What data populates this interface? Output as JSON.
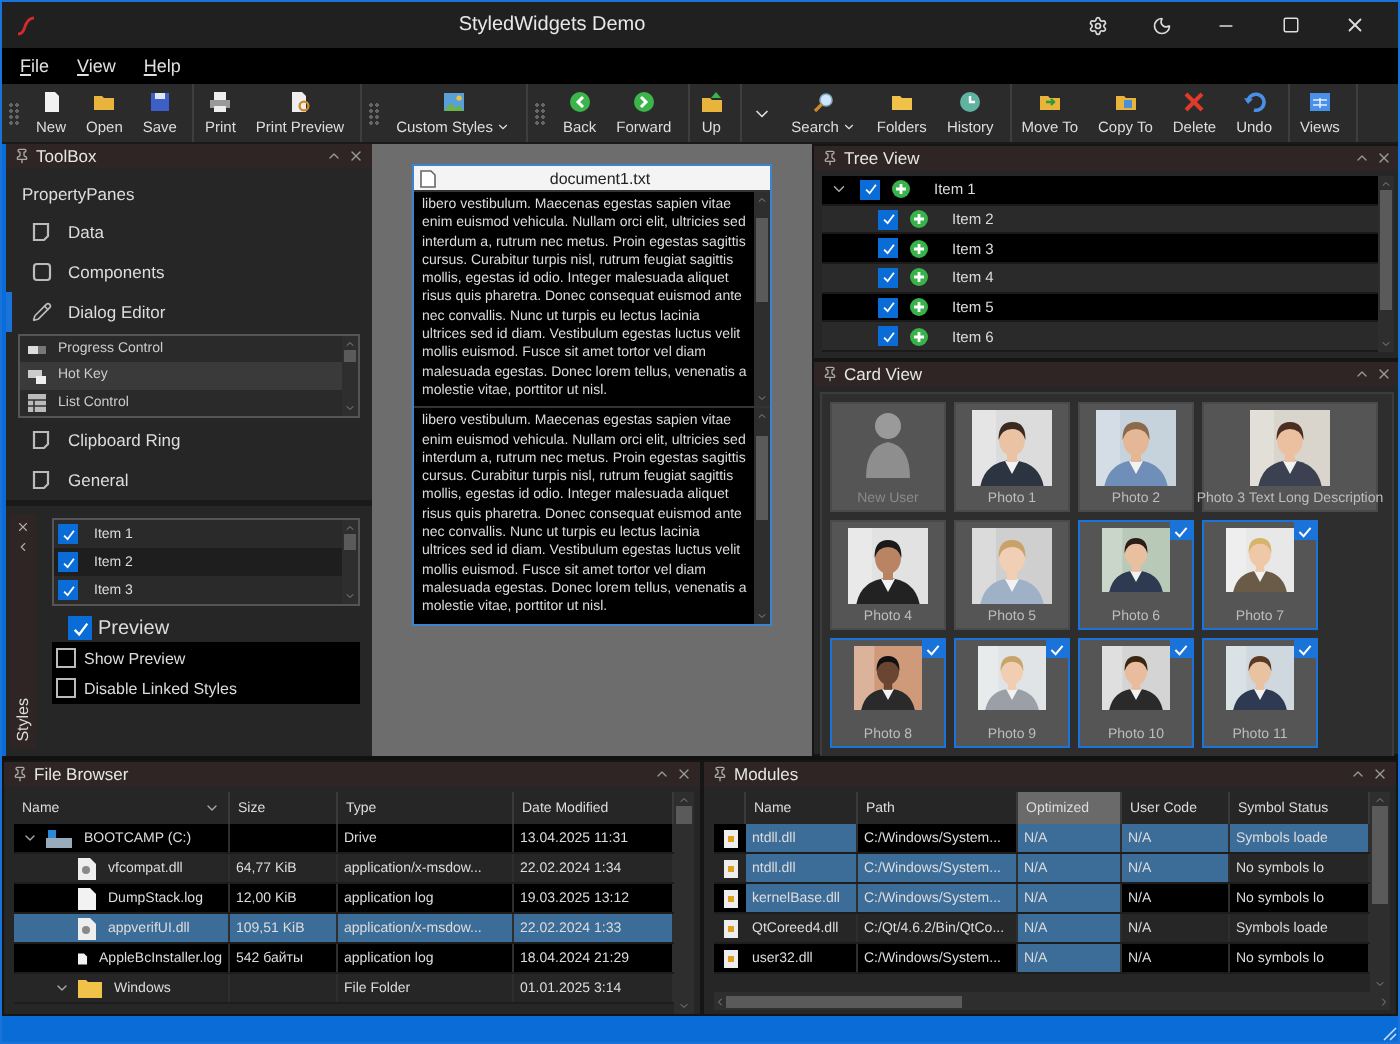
{
  "window": {
    "title": "StyledWidgets Demo"
  },
  "menu": [
    "File",
    "View",
    "Help"
  ],
  "toolbar": [
    {
      "items": [
        {
          "kind": "button",
          "label": "New",
          "dropdown": false
        },
        {
          "kind": "button",
          "label": "Open",
          "dropdown": false
        },
        {
          "kind": "button",
          "label": "Save",
          "dropdown": false
        }
      ]
    },
    {
      "items": [
        {
          "kind": "button",
          "label": "Print",
          "dropdown": false
        },
        {
          "kind": "button",
          "label": "Print Preview",
          "dropdown": false
        }
      ]
    },
    {
      "items": [
        {
          "kind": "button",
          "label": "Custom Styles",
          "dropdown": true
        }
      ]
    },
    {
      "items": [
        {
          "kind": "button",
          "label": "Back",
          "dropdown": false
        },
        {
          "kind": "button",
          "label": "Forward",
          "dropdown": false
        }
      ]
    },
    {
      "items": [
        {
          "kind": "button",
          "label": "Up",
          "dropdown": false
        }
      ]
    },
    {
      "items": [
        {
          "kind": "menu"
        },
        {
          "kind": "button",
          "label": "Search",
          "dropdown": true
        },
        {
          "kind": "button",
          "label": "Folders",
          "dropdown": false
        },
        {
          "kind": "button",
          "label": "History",
          "dropdown": false
        }
      ]
    },
    {
      "items": [
        {
          "kind": "button",
          "label": "Move To",
          "dropdown": false
        },
        {
          "kind": "button",
          "label": "Copy To",
          "dropdown": false
        },
        {
          "kind": "button",
          "label": "Delete",
          "dropdown": false
        },
        {
          "kind": "button",
          "label": "Undo",
          "dropdown": false
        }
      ]
    },
    {
      "items": [
        {
          "kind": "button",
          "label": "Views",
          "dropdown": false
        }
      ]
    }
  ],
  "toolbox": {
    "title": "ToolBox",
    "heading": "PropertyPanes",
    "items": [
      {
        "label": "Data",
        "selected": false
      },
      {
        "label": "Components",
        "selected": false
      },
      {
        "label": "Dialog Editor",
        "selected": true,
        "controls": [
          {
            "label": "Progress Control",
            "selected": false
          },
          {
            "label": "Hot Key",
            "selected": true
          },
          {
            "label": "List Control",
            "selected": false
          }
        ]
      },
      {
        "label": "Clipboard Ring",
        "selected": false
      },
      {
        "label": "General",
        "selected": false
      }
    ]
  },
  "styles_panel": {
    "tab": "Styles",
    "list": [
      {
        "label": "Item 1",
        "checked": true
      },
      {
        "label": "Item 2",
        "checked": true
      },
      {
        "label": "Item 3",
        "checked": true
      }
    ],
    "preview": {
      "label": "Preview",
      "checked": true
    },
    "options": [
      {
        "label": "Show Preview",
        "checked": false
      },
      {
        "label": "Disable Linked Styles",
        "checked": false
      }
    ]
  },
  "document": {
    "title": "document1.txt",
    "panes": [
      "libero vestibulum. Maecenas egestas sapien vitae enim euismod vehicula. Nullam orci elit, ultricies sed interdum a, rutrum nec metus. Proin egestas sagittis cursus. Curabitur turpis nisl, rutrum feugiat sagittis mollis, egestas id odio. Integer malesuada aliquet risus quis pharetra. Donec consequat euismod ante nec convallis. Nunc ut turpis eu lectus lacinia ultrices sed id diam. Vestibulum egestas luctus velit mollis euismod. Fusce sit amet tortor vel diam malesuada egestas. Donec lorem tellus, venenatis a molestie vitae, porttitor ut nisl.",
      "libero vestibulum. Maecenas egestas sapien vitae enim euismod vehicula. Nullam orci elit, ultricies sed interdum a, rutrum nec metus. Proin egestas sagittis cursus. Curabitur turpis nisl, rutrum feugiat sagittis mollis, egestas id odio. Integer malesuada aliquet risus quis pharetra. Donec consequat euismod ante nec convallis. Nunc ut turpis eu lectus lacinia ultrices sed id diam. Vestibulum egestas luctus velit mollis euismod. Fusce sit amet tortor vel diam malesuada egestas. Donec lorem tellus, venenatis a molestie vitae, porttitor ut nisl."
    ]
  },
  "tree_view": {
    "title": "Tree View",
    "items": [
      {
        "label": "Item 1",
        "checked": true,
        "expanded": true,
        "children": [
          {
            "label": "Item 2",
            "checked": true
          },
          {
            "label": "Item 3",
            "checked": true
          },
          {
            "label": "Item 4",
            "checked": true
          },
          {
            "label": "Item 5",
            "checked": true
          },
          {
            "label": "Item 6",
            "checked": true
          }
        ]
      }
    ]
  },
  "card_view": {
    "title": "Card View",
    "cards": [
      {
        "kind": "placeholder",
        "label": "New User",
        "selected": false
      },
      {
        "label": "Photo 1",
        "selected": false
      },
      {
        "label": "Photo 2",
        "selected": false
      },
      {
        "label": "Photo 3 Text Long  Description",
        "selected": false
      },
      {
        "label": "Photo 4",
        "selected": false
      },
      {
        "label": "Photo 5",
        "selected": false
      },
      {
        "label": "Photo 6",
        "selected": true
      },
      {
        "label": "Photo 7",
        "selected": true
      },
      {
        "label": "Photo 8",
        "selected": true
      },
      {
        "label": "Photo 9",
        "selected": true
      },
      {
        "label": "Photo 10",
        "selected": true
      },
      {
        "label": "Photo 11",
        "selected": true
      }
    ]
  },
  "file_browser": {
    "title": "File Browser",
    "columns": [
      {
        "label": "Name",
        "sorted": true
      },
      {
        "label": "Size",
        "sorted": false
      },
      {
        "label": "Type",
        "sorted": false
      },
      {
        "label": "Date Modified",
        "sorted": false
      }
    ],
    "rows": [
      {
        "kind": "drive",
        "name": "BOOTCAMP (C:)",
        "type": "Drive",
        "date": "13.04.2025 11:31",
        "selected": false,
        "expanded": true,
        "children": [
          {
            "kind": "dll",
            "name": "vfcompat.dll",
            "size": "64,77 KiB",
            "type": "application/x-msdow...",
            "date": "22.02.2024 1:34",
            "selected": false
          },
          {
            "kind": "log",
            "name": "DumpStack.log",
            "size": "12,00 KiB",
            "type": "application log",
            "date": "19.03.2025 13:12",
            "selected": false
          },
          {
            "kind": "dll",
            "name": "appverifUI.dll",
            "size": "109,51 KiB",
            "type": "application/x-msdow...",
            "date": "22.02.2024 1:33",
            "selected": true
          },
          {
            "kind": "log",
            "name": "AppleBcInstaller.log",
            "size": "542 байты",
            "type": "application log",
            "date": "18.04.2024 21:29",
            "selected": false
          },
          {
            "kind": "folder",
            "name": "Windows",
            "type": "File Folder",
            "date": "01.01.2025 3:14",
            "selected": false,
            "expanded": true
          }
        ]
      }
    ]
  },
  "modules": {
    "title": "Modules",
    "columns": [
      {
        "label": "Name",
        "selected": false
      },
      {
        "label": "Path",
        "selected": false
      },
      {
        "label": "Optimized",
        "selected": true
      },
      {
        "label": "User Code",
        "selected": false
      },
      {
        "label": "Symbol Status",
        "selected": false
      }
    ],
    "rows": [
      {
        "cells": [
          {
            "text": "ntdll.dll",
            "selected": true
          },
          {
            "text": "C:/Windows/System...",
            "selected": false
          },
          {
            "text": "N/A",
            "selected": true
          },
          {
            "text": "N/A",
            "selected": true
          },
          {
            "text": "Symbols loade",
            "selected": true
          }
        ]
      },
      {
        "cells": [
          {
            "text": "ntdll.dll",
            "selected": true
          },
          {
            "text": "C:/Windows/System...",
            "selected": true
          },
          {
            "text": "N/A",
            "selected": true
          },
          {
            "text": "N/A",
            "selected": true
          },
          {
            "text": "No symbols lo",
            "selected": false
          }
        ]
      },
      {
        "cells": [
          {
            "text": "kernelBase.dll",
            "selected": true
          },
          {
            "text": "C:/Windows/System...",
            "selected": true
          },
          {
            "text": "N/A",
            "selected": true
          },
          {
            "text": "N/A",
            "selected": false
          },
          {
            "text": "No symbols lo",
            "selected": false
          }
        ]
      },
      {
        "cells": [
          {
            "text": "QtCoreed4.dll",
            "selected": false
          },
          {
            "text": "C:/Qt/4.6.2/Bin/QtCo...",
            "selected": false
          },
          {
            "text": "N/A",
            "selected": true
          },
          {
            "text": "N/A",
            "selected": false
          },
          {
            "text": "Symbols loade",
            "selected": false
          }
        ]
      },
      {
        "cells": [
          {
            "text": "user32.dll",
            "selected": false
          },
          {
            "text": "C:/Windows/System...",
            "selected": false
          },
          {
            "text": "N/A",
            "selected": true
          },
          {
            "text": "N/A",
            "selected": false
          },
          {
            "text": "No symbols lo",
            "selected": false
          }
        ]
      }
    ]
  }
}
